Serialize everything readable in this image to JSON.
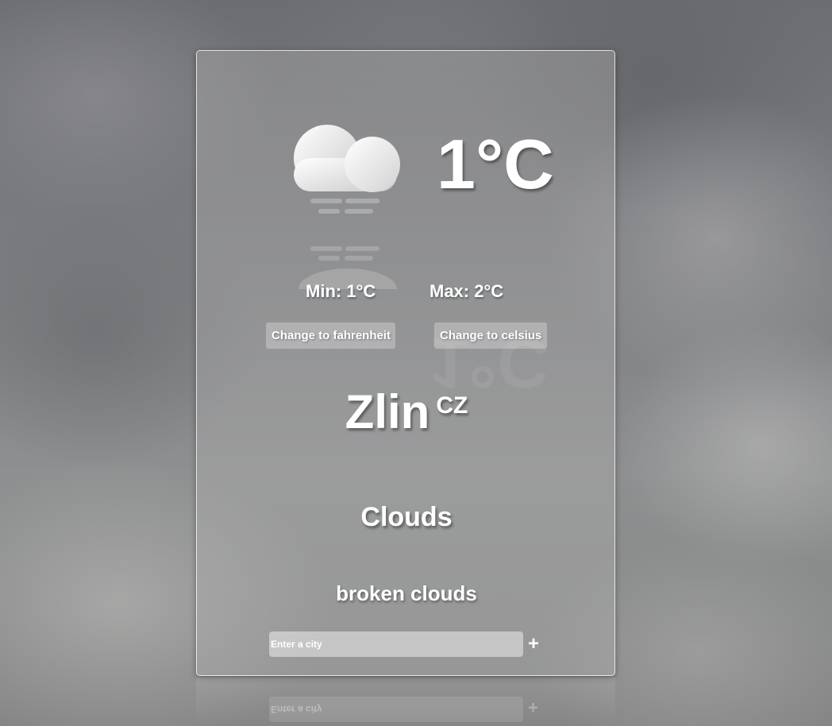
{
  "weather": {
    "icon": "broken-clouds-icon",
    "temperature": "1°C",
    "min": "Min: 1°C",
    "max": "Max: 2°C",
    "city": "Zlin",
    "country": "CZ",
    "main": "Clouds",
    "description": "broken clouds"
  },
  "controls": {
    "to_fahrenheit_label": "Change to fahrenheit",
    "to_celsius_label": "Change to celsius",
    "search_placeholder": "Enter a city",
    "add_label": "+"
  },
  "colors": {
    "text": "#ffffff",
    "card_border": "#ffffff"
  }
}
